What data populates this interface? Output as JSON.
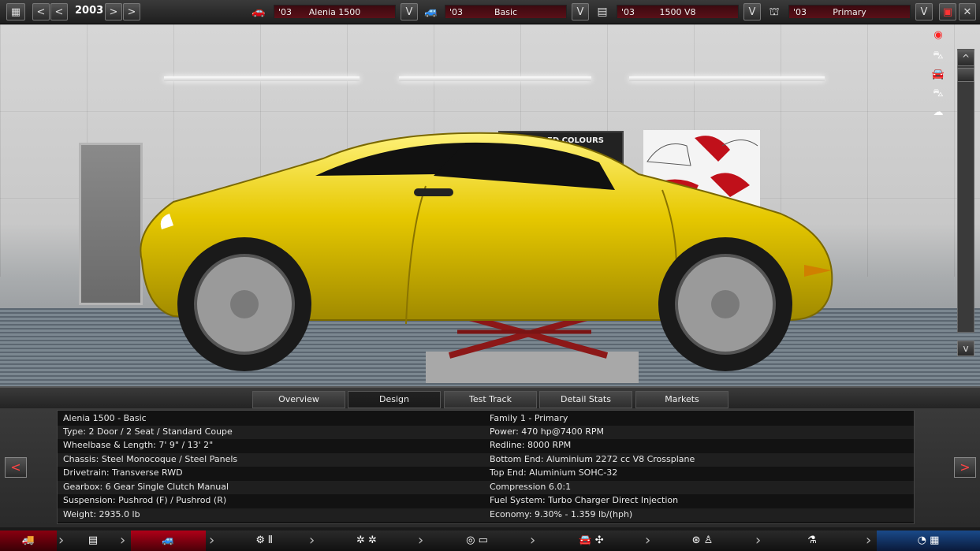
{
  "topbar": {
    "year": "2003",
    "car_select": {
      "year": "'03",
      "name": "Alenia 1500"
    },
    "trim_select": {
      "year": "'03",
      "name": "Basic"
    },
    "engine_select": {
      "year": "'03",
      "name": "1500 V8"
    },
    "engine_family_select": {
      "year": "'03",
      "name": "Primary"
    },
    "dropdown_label": "V",
    "prev_label": "<",
    "next_label": ">"
  },
  "scene": {
    "poster_text": "ED COLOURS"
  },
  "tabs": [
    {
      "label": "Overview"
    },
    {
      "label": "Design"
    },
    {
      "label": "Test Track"
    },
    {
      "label": "Detail Stats"
    },
    {
      "label": "Markets"
    }
  ],
  "active_tab": "Design",
  "info": {
    "left": [
      "Alenia 1500 - Basic",
      "Type: 2 Door / 2 Seat / Standard Coupe",
      "Wheelbase & Length: 7' 9\" / 13' 2\"",
      "Chassis: Steel Monocoque / Steel Panels",
      "Drivetrain: Transverse RWD",
      "Gearbox: 6 Gear Single Clutch Manual",
      "Suspension: Pushrod (F) / Pushrod (R)",
      "Weight: 2935.0 lb"
    ],
    "right": [
      "Family 1 - Primary",
      "Power: 470 hp@7400 RPM",
      "Redline: 8000 RPM",
      "Bottom End: Aluminium 2272 cc V8 Crossplane",
      "Top End: Aluminium SOHC-32",
      "Compression 6.0:1",
      "Fuel System: Turbo Charger Direct Injection",
      "Economy: 9.30% - 1.359 lb/(hph)"
    ]
  },
  "nav": {
    "prev": "<",
    "next": ">"
  },
  "colors": {
    "car": "#e6c800",
    "accent_red": "#b00010",
    "panel": "#121212"
  }
}
